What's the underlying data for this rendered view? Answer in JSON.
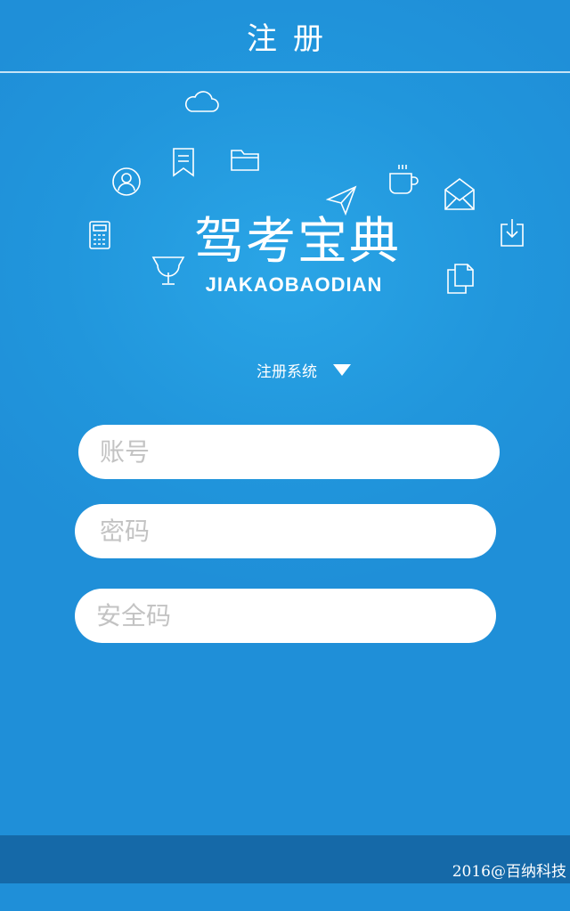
{
  "header": {
    "title": "注册"
  },
  "logo": {
    "title_cn": "驾考宝典",
    "title_en": "JIAKAOBAODIAN"
  },
  "system_select": {
    "label": "注册系统"
  },
  "form": {
    "account_placeholder": "账号",
    "password_placeholder": "密码",
    "security_code_placeholder": "安全码"
  },
  "footer": {
    "copyright": "2016@百纳科技"
  },
  "icons": [
    "cloud-icon",
    "bookmark-icon",
    "folder-icon",
    "user-icon",
    "coffee-cup-icon",
    "paper-plane-icon",
    "mail-icon",
    "calculator-icon",
    "download-icon",
    "trophy-icon",
    "documents-icon",
    "caret-down-icon"
  ],
  "colors": {
    "background": "#2196dc",
    "footer": "#1569a8",
    "text": "#ffffff"
  }
}
